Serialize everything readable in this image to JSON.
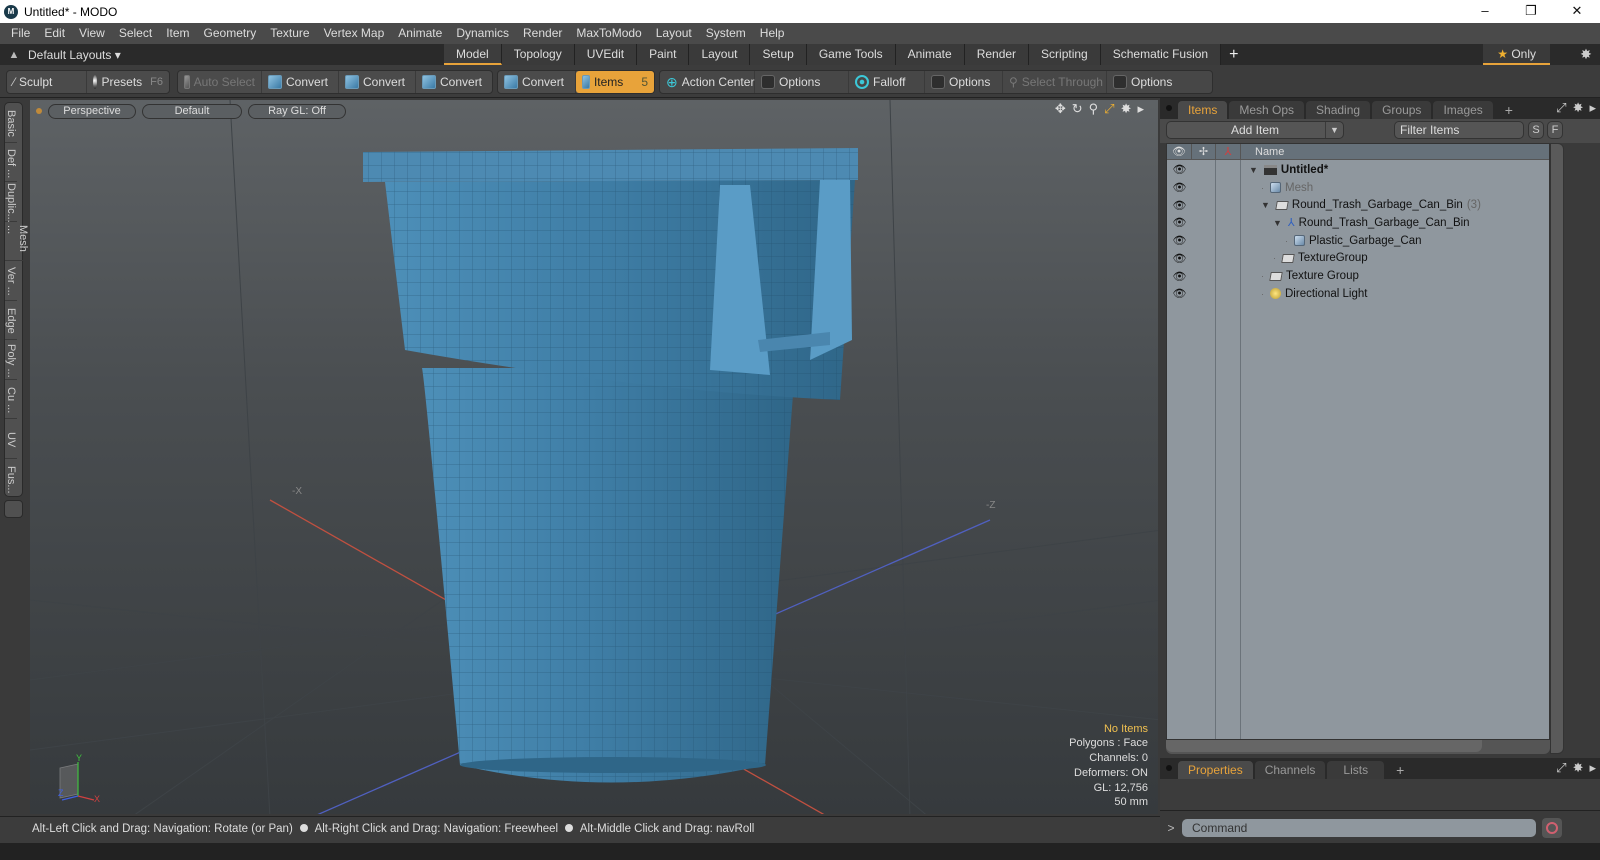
{
  "window": {
    "title": "Untitled* - MODO",
    "controls": {
      "minimize": "–",
      "maximize": "❐",
      "close": "✕"
    }
  },
  "menu": [
    "File",
    "Edit",
    "View",
    "Select",
    "Item",
    "Geometry",
    "Texture",
    "Vertex Map",
    "Animate",
    "Dynamics",
    "Render",
    "MaxToModo",
    "Layout",
    "System",
    "Help"
  ],
  "layoutbar": {
    "layout_name": "Default Layouts ▾",
    "tabs": [
      {
        "label": "Model",
        "active": true
      },
      {
        "label": "Topology"
      },
      {
        "label": "UVEdit"
      },
      {
        "label": "Paint"
      },
      {
        "label": "Layout"
      },
      {
        "label": "Setup"
      },
      {
        "label": "Game Tools"
      },
      {
        "label": "Animate"
      },
      {
        "label": "Render"
      },
      {
        "label": "Scripting"
      },
      {
        "label": "Schematic Fusion"
      }
    ],
    "add_tab": "+",
    "only_label": "Only",
    "accent": "#e8a33a"
  },
  "toolbar": {
    "sculpt": "Sculpt",
    "presets": "Presets",
    "presets_key": "F6",
    "auto_select": "Auto Select",
    "convert1": "Convert",
    "convert2": "Convert",
    "convert3": "Convert",
    "convert4": "Convert",
    "items": "Items",
    "items_count": "5",
    "action_center": "Action Center",
    "options1": "Options",
    "falloff": "Falloff",
    "options2": "Options",
    "select_through": "Select Through",
    "options3": "Options"
  },
  "left_tabs": [
    "Basic",
    "Def ...",
    "Duplic...",
    "Mesh ...",
    "Ver ...",
    "Edge",
    "Poly ...",
    "Cu ...",
    "UV",
    "Fus..."
  ],
  "viewport": {
    "view": "Perspective",
    "shading": "Default",
    "raygl": "Ray GL: Off",
    "axis_labels": {
      "x": "X",
      "y": "Y",
      "z": "Z",
      "neg_x": "-X",
      "neg_z": "-Z"
    },
    "stats": {
      "selection": "No Items",
      "polygons": "Polygons : Face",
      "channels": "Channels: 0",
      "deformers": "Deformers: ON",
      "gl": "GL: 12,756",
      "scale": "50 mm"
    },
    "model_color": "#3f7ea6"
  },
  "statusbar": {
    "hint1": "Alt-Left Click and Drag: Navigation: Rotate (or Pan)",
    "hint2": "Alt-Right Click and Drag: Navigation: Freewheel",
    "hint3": "Alt-Middle Click and Drag: navRoll"
  },
  "items_panel": {
    "tabs": [
      {
        "label": "Items",
        "active": true
      },
      {
        "label": "Mesh Ops"
      },
      {
        "label": "Shading"
      },
      {
        "label": "Groups"
      },
      {
        "label": "Images"
      }
    ],
    "add_item": "Add Item",
    "filter_placeholder": "Filter Items",
    "s_btn": "S",
    "f_btn": "F",
    "column_name": "Name",
    "tree": [
      {
        "name": "Untitled*",
        "type": "scene",
        "depth": 0,
        "expanded": true,
        "bold": true
      },
      {
        "name": "Mesh",
        "type": "mesh",
        "depth": 1,
        "dim": true
      },
      {
        "name": "Round_Trash_Garbage_Can_Bin",
        "type": "group",
        "depth": 1,
        "expanded": true,
        "count": "(3)"
      },
      {
        "name": "Round_Trash_Garbage_Can_Bin",
        "type": "locator",
        "depth": 2,
        "expanded": true
      },
      {
        "name": "Plastic_Garbage_Can",
        "type": "mesh",
        "depth": 3
      },
      {
        "name": "TextureGroup",
        "type": "group",
        "depth": 2
      },
      {
        "name": "Texture Group",
        "type": "group",
        "depth": 1
      },
      {
        "name": "Directional Light",
        "type": "light",
        "depth": 1
      }
    ]
  },
  "properties_panel": {
    "tabs": [
      {
        "label": "Properties",
        "active": true
      },
      {
        "label": "Channels"
      },
      {
        "label": "Lists"
      }
    ]
  },
  "command": {
    "prompt": ">",
    "placeholder": "Command"
  }
}
